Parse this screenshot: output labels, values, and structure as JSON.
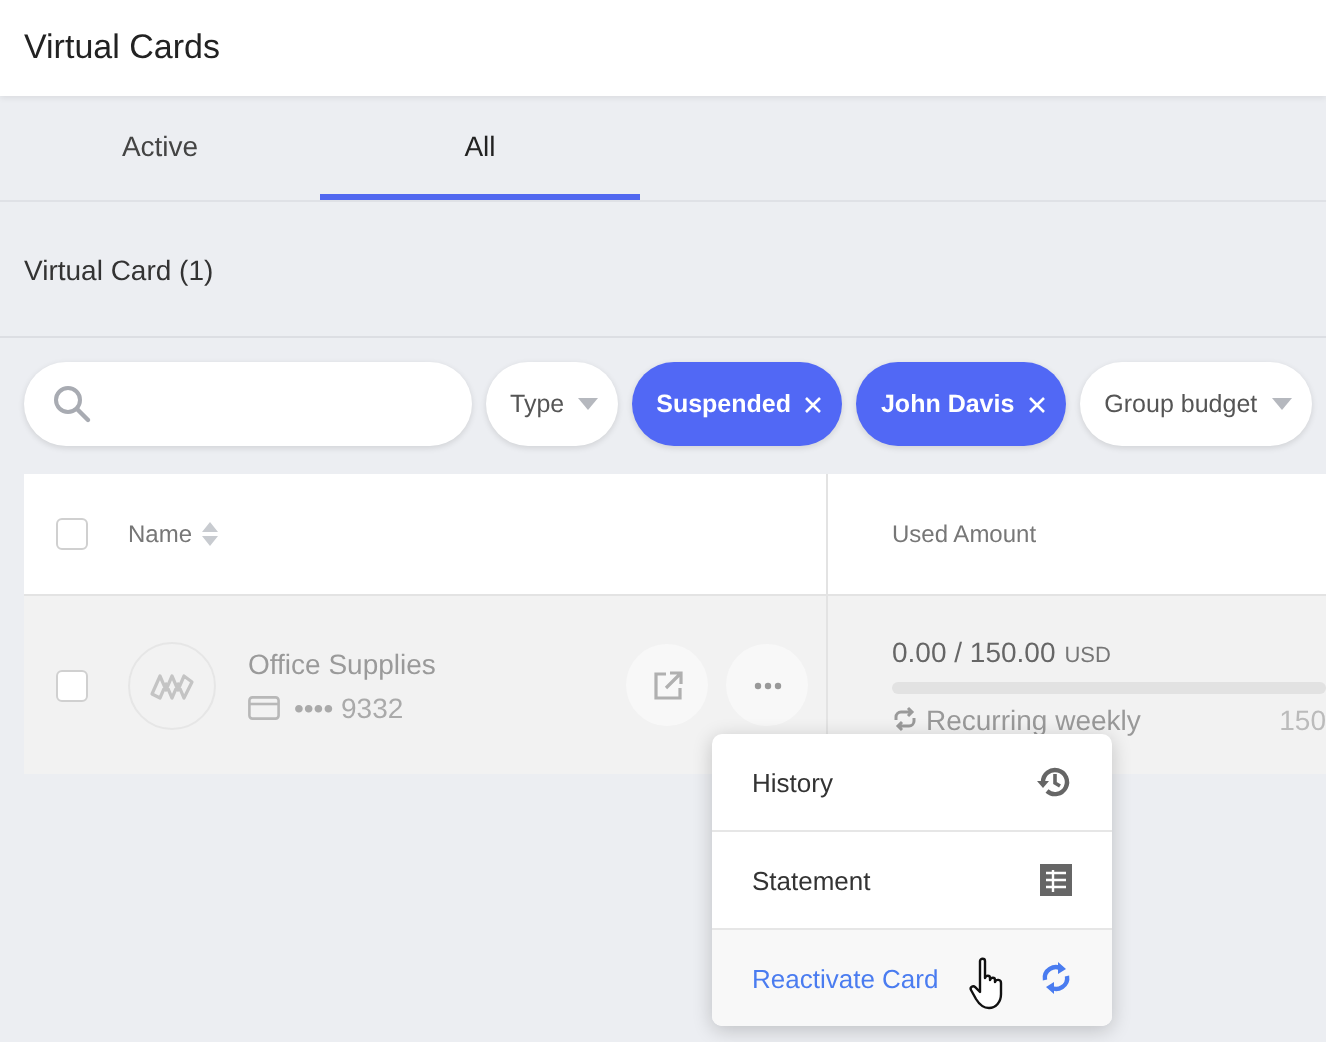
{
  "page_title": "Virtual Cards",
  "tabs": [
    {
      "label": "Active",
      "selected": false
    },
    {
      "label": "All",
      "selected": true
    }
  ],
  "section_title": "Virtual Card (1)",
  "filters": [
    {
      "kind": "dropdown",
      "label": "Type"
    },
    {
      "kind": "chip",
      "label": "Suspended"
    },
    {
      "kind": "chip",
      "label": "John Davis"
    },
    {
      "kind": "dropdown",
      "label": "Group budget"
    }
  ],
  "table": {
    "select_all": {
      "checked": false
    },
    "columns": [
      "Name",
      "Used Amount"
    ],
    "rows": [
      {
        "checked": false,
        "name": "Office Supplies",
        "card_number": "•••• 9332",
        "amount": "0.00 / 150.00",
        "currency": "USD",
        "level": 0,
        "recurrence": "Recurring weekly",
        "column_3": "150"
      }
    ]
  },
  "menu": [
    {
      "kind": "history",
      "label": "History",
      "highlighted": false
    },
    {
      "kind": "statement",
      "label": "Statement",
      "highlighted": false
    },
    {
      "kind": "reactivate",
      "label": "Reactivate Card",
      "highlighted": true
    }
  ]
}
